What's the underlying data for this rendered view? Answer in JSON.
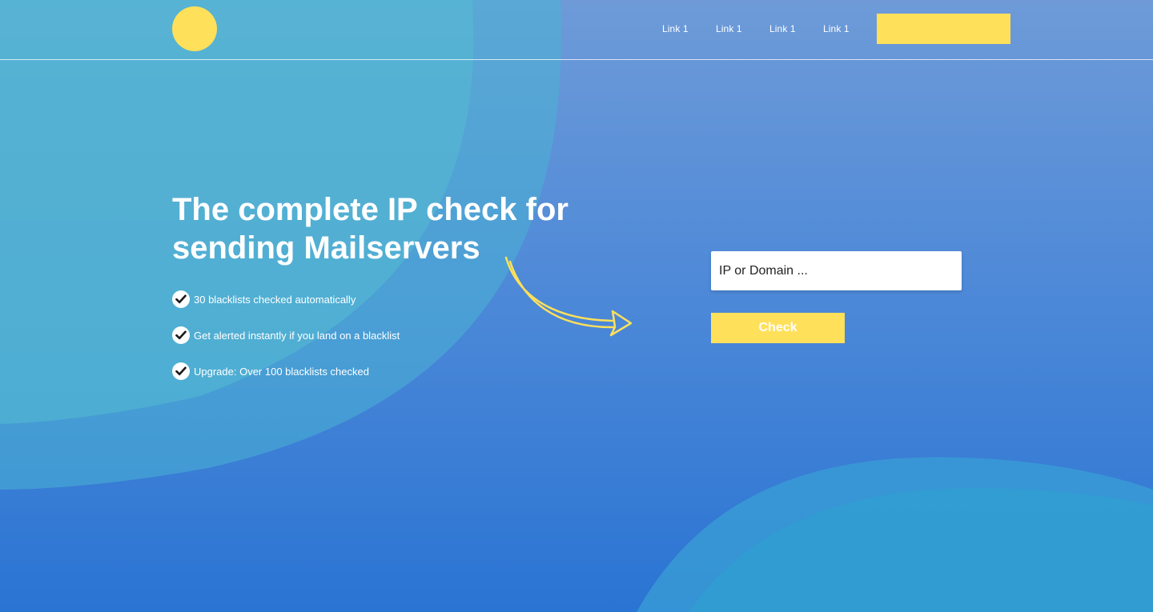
{
  "nav": {
    "links": [
      "Link 1",
      "Link 1",
      "Link 1",
      "Link 1"
    ],
    "cta_label": ""
  },
  "hero": {
    "title_line1": "The complete IP check for",
    "title_line2": "sending Mailservers",
    "features": [
      "30 blacklists checked automatically",
      "Get alerted instantly if you land on a blacklist",
      "Upgrade: Over 100 blacklists checked"
    ]
  },
  "search": {
    "placeholder": "IP or Domain ...",
    "button_label": "Check"
  },
  "colors": {
    "accent": "#ffe05a",
    "background_top": "#6e9bd8",
    "background_bottom": "#2a74d3",
    "blob": "#4ab3d6",
    "text": "#ffffff"
  },
  "icons": [
    "check-icon",
    "curved-arrow-icon"
  ]
}
